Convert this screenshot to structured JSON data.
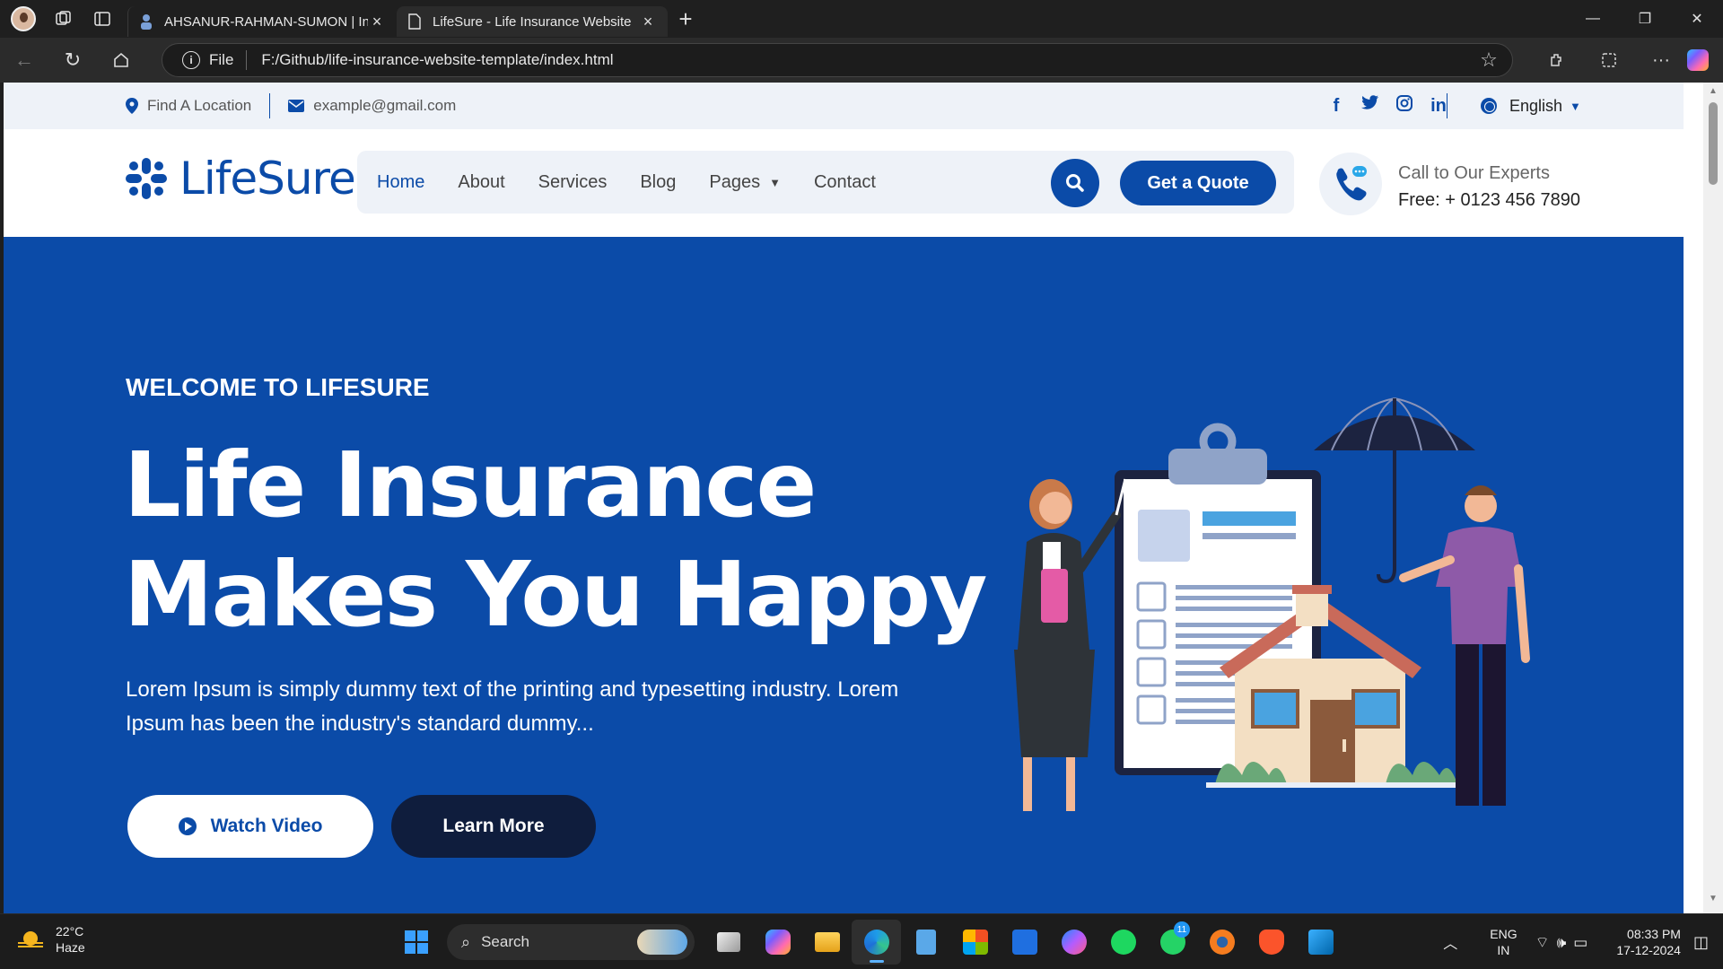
{
  "browser": {
    "tabs": [
      {
        "title": "AHSANUR-RAHMAN-SUMON | In",
        "active": false
      },
      {
        "title": "LifeSure - Life Insurance Website",
        "active": true
      }
    ],
    "new_tab_symbol": "+",
    "url_scheme_label": "File",
    "url": "F:/Github/life-insurance-website-template/index.html"
  },
  "site": {
    "topbar": {
      "location": "Find A Location",
      "email": "example@gmail.com",
      "social": [
        "f",
        "t",
        "ig",
        "in"
      ],
      "language": "English"
    },
    "brand": "LifeSure",
    "menu": [
      "Home",
      "About",
      "Services",
      "Blog",
      "Pages",
      "Contact"
    ],
    "quote_button": "Get a Quote",
    "call": {
      "line1": "Call to Our Experts",
      "line2": "Free: + 0123 456 7890"
    },
    "hero": {
      "kicker": "WELCOME TO LIFESURE",
      "title_line1": "Life Insurance",
      "title_line2": "Makes You Happy",
      "description": "Lorem Ipsum is simply dummy text of the printing and typesetting industry. Lorem Ipsum has been the industry's standard dummy...",
      "watch_button": "Watch Video",
      "learn_button": "Learn More"
    },
    "colors": {
      "primary": "#0b4ba8",
      "dark": "#0f1d3d",
      "light": "#eef2f8"
    }
  },
  "taskbar": {
    "weather_temp": "22°C",
    "weather_desc": "Haze",
    "search_label": "Search",
    "whatsapp_badge": "11",
    "lang_line1": "ENG",
    "lang_line2": "IN",
    "time": "08:33 PM",
    "date": "17-12-2024"
  }
}
